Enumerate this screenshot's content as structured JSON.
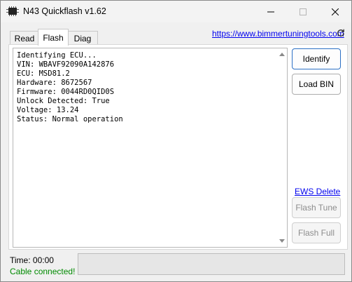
{
  "window": {
    "title": "N43 Quickflash v1.62"
  },
  "tabs": [
    {
      "label": "Read",
      "active": false
    },
    {
      "label": "Flash",
      "active": true
    },
    {
      "label": "Diag",
      "active": false
    }
  ],
  "header": {
    "link": "https://www.bimmertuningtools.com"
  },
  "log": {
    "lines": [
      "Identifying ECU...",
      "VIN: WBAVF92090A142876",
      "ECU: MSD81.2",
      "Hardware: 8672567",
      "Firmware: 0044RD0QID0S",
      "Unlock Detected: True",
      "Voltage: 13.24",
      "Status: Normal operation"
    ]
  },
  "buttons": {
    "identify": "Identify",
    "load_bin": "Load BIN",
    "ews_delete": "EWS Delete",
    "flash_tune": "Flash Tune",
    "flash_full": "Flash Full"
  },
  "status": {
    "time": "Time: 00:00",
    "cable": "Cable connected!",
    "progress": 0
  },
  "colors": {
    "link": "#0000ee",
    "cable_ok": "#008a00",
    "primary_border": "#2b6fc4"
  }
}
